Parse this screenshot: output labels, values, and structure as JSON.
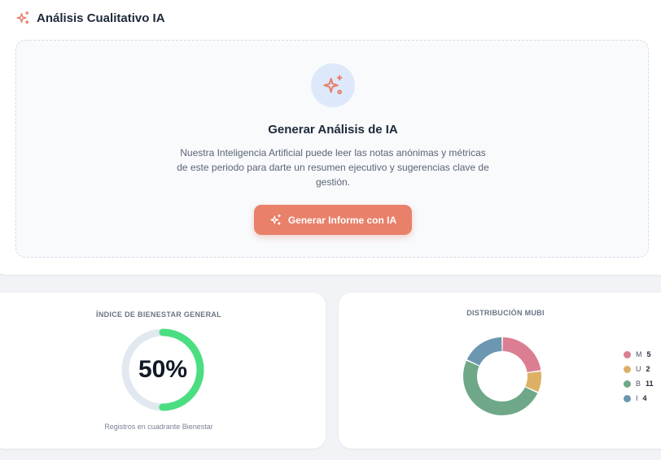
{
  "section": {
    "title": "Análisis Cualitativo IA"
  },
  "ai_panel": {
    "heading": "Generar Análisis de IA",
    "description": "Nuestra Inteligencia Artificial puede leer las notas anónimas y métricas de este periodo para darte un resumen ejecutivo y sugerencias clave de gestión.",
    "button_label": "Generar Informe con IA"
  },
  "wellbeing": {
    "title": "ÍNDICE DE BIENESTAR GENERAL",
    "value": "50%",
    "fraction": 0.5,
    "caption": "Registros en cuadrante Bienestar"
  },
  "distribution": {
    "title": "DISTRIBUCIÓN MUBI"
  },
  "colors": {
    "accent": "#e8806a",
    "gauge_fill": "#4ade80",
    "gauge_track": "#e2e8f0"
  },
  "chart_data": {
    "type": "pie",
    "categories": [
      "M",
      "U",
      "B",
      "I"
    ],
    "values": [
      5,
      2,
      11,
      4
    ],
    "colors": [
      "#db7e92",
      "#deb064",
      "#6fa888",
      "#6b97b1"
    ],
    "legend": "right"
  }
}
